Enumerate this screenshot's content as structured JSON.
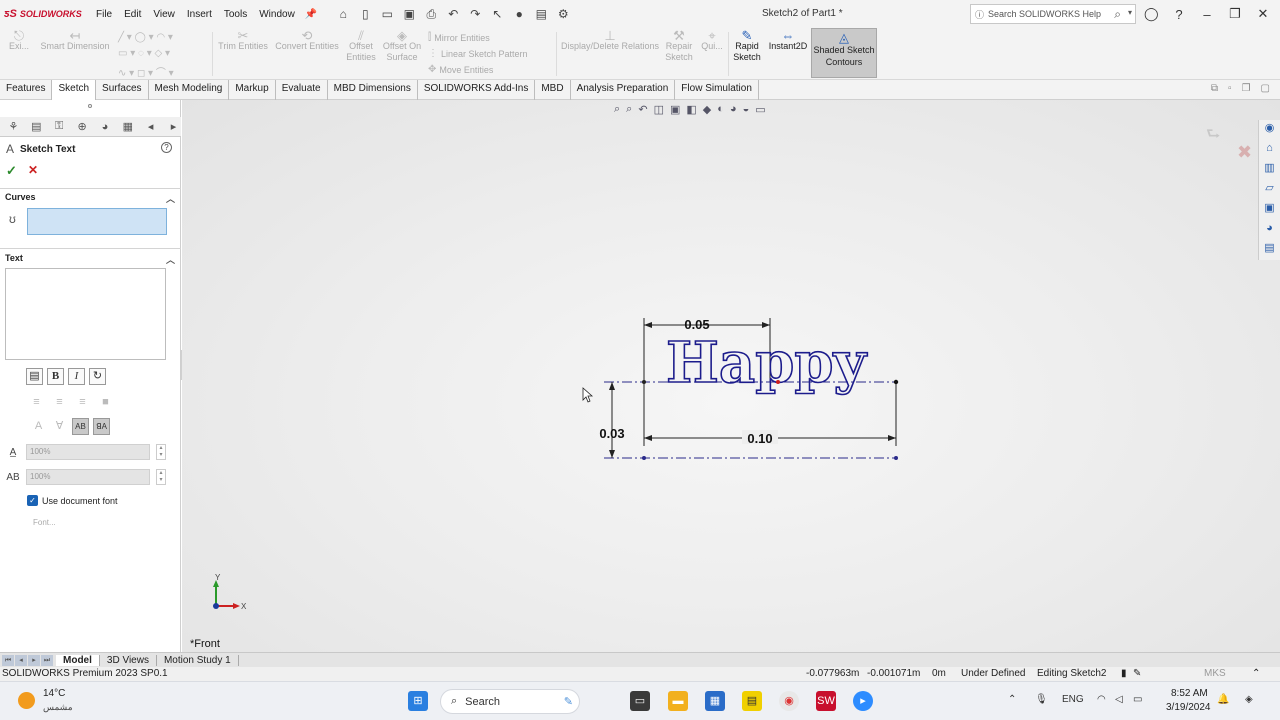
{
  "app": {
    "brand": "SOLIDWORKS",
    "window_title": "Sketch2 of Part1 *",
    "menu": [
      "File",
      "Edit",
      "View",
      "Insert",
      "Tools",
      "Window"
    ],
    "help_search_placeholder": "Search SOLIDWORKS Help"
  },
  "ribbon": {
    "exit": "Exi...",
    "smart_dimension": "Smart Dimension",
    "trim_entities": "Trim Entities",
    "convert_entities": "Convert Entities",
    "offset_entities": "Offset Entities",
    "offset_on_surface": "Offset On Surface",
    "mirror_entities": "Mirror Entities",
    "linear_sketch_pattern": "Linear Sketch Pattern",
    "move_entities": "Move Entities",
    "display_delete_relations": "Display/Delete Relations",
    "repair_sketch": "Repair Sketch",
    "quick_snaps": "Qui...",
    "rapid_sketch": "Rapid Sketch",
    "instant2d": "Instant2D",
    "shaded_sketch_contours": "Shaded Sketch Contours"
  },
  "tabs": [
    "Features",
    "Sketch",
    "Surfaces",
    "Mesh Modeling",
    "Markup",
    "Evaluate",
    "MBD Dimensions",
    "SOLIDWORKS Add-Ins",
    "MBD",
    "Analysis Preparation",
    "Flow Simulation"
  ],
  "active_tab": "Sketch",
  "property_manager": {
    "title": "Sketch Text",
    "curves_label": "Curves",
    "text_label": "Text",
    "text_value": "",
    "width_factor": "100%",
    "spacing": "100%",
    "use_document_font": "Use document font",
    "font_button": "Font..."
  },
  "graphics": {
    "view_name": "*Front",
    "sketch_text": "Happy",
    "dim_top": "0.05",
    "dim_left": "0.03",
    "dim_bottom": "0.10",
    "axis_x": "X",
    "axis_y": "Y"
  },
  "bottom_tabs": [
    "Model",
    "3D Views",
    "Motion Study 1"
  ],
  "status": {
    "product": "SOLIDWORKS Premium 2023 SP0.1",
    "x": "-0.077963m",
    "y": "-0.001071m",
    "z": "0m",
    "state": "Under Defined",
    "editing": "Editing Sketch2",
    "units": "MKS"
  },
  "taskbar": {
    "temperature": "14°C",
    "weather": "مشمس",
    "search": "Search",
    "language": "ENG",
    "time": "8:52 AM",
    "date": "3/19/2024"
  }
}
